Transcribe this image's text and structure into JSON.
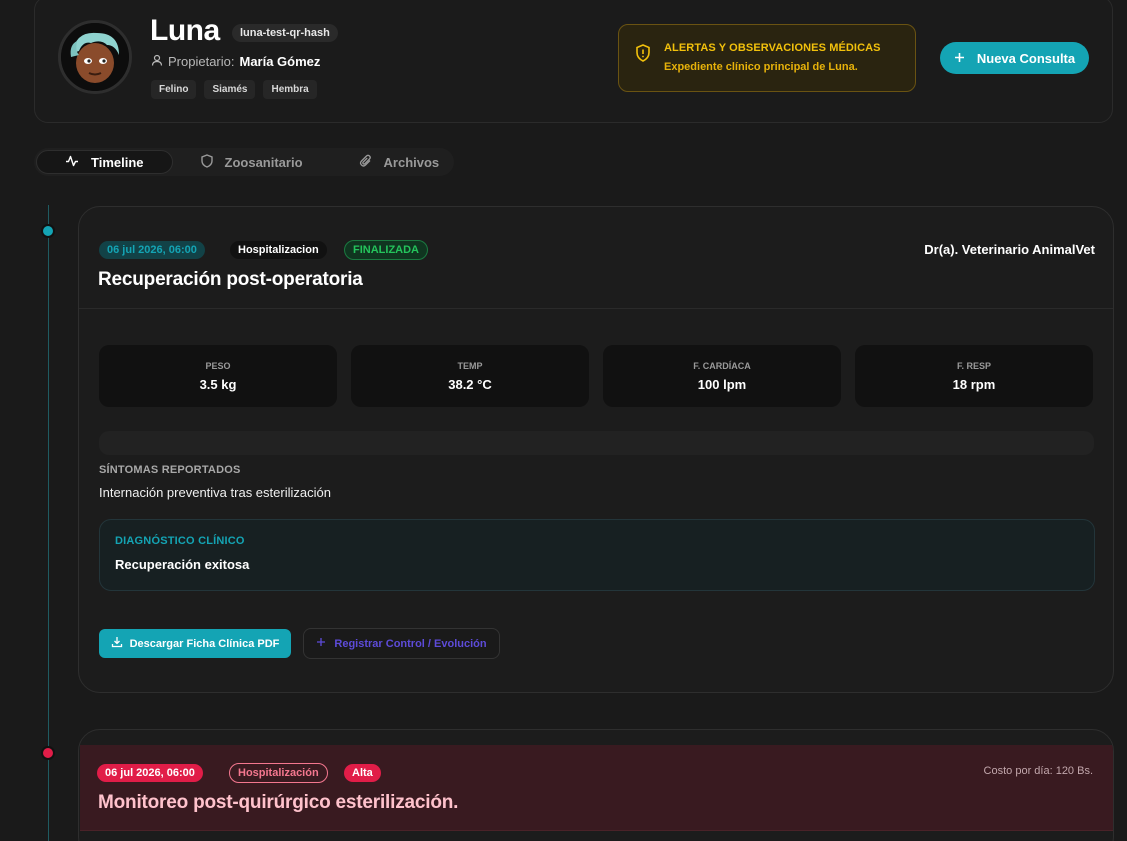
{
  "patient": {
    "name": "Luna",
    "hash": "luna-test-qr-hash",
    "owner_label": "Propietario:",
    "owner_name": "María Gómez",
    "tags": [
      "Felino",
      "Siamés",
      "Hembra"
    ]
  },
  "alert": {
    "title": "ALERTAS Y OBSERVACIONES MÉDICAS",
    "text": "Expediente clínico principal de Luna."
  },
  "actions": {
    "new_consult": "Nueva Consulta"
  },
  "tabs": [
    {
      "label": "Timeline",
      "icon": "activity-icon",
      "active": true
    },
    {
      "label": "Zoosanitario",
      "icon": "shield-icon",
      "active": false
    },
    {
      "label": "Archivos",
      "icon": "paperclip-icon",
      "active": false
    }
  ],
  "entry1": {
    "date": "06 jul 2026, 06:00",
    "type": "Hospitalizacion",
    "status": "FINALIZADA",
    "vet": "Dr(a). Veterinario AnimalVet",
    "title": "Recuperación post-operatoria",
    "vitals": [
      {
        "label": "PESO",
        "value": "3.5 kg"
      },
      {
        "label": "TEMP",
        "value": "38.2 °C"
      },
      {
        "label": "F. CARDÍACA",
        "value": "100 lpm"
      },
      {
        "label": "F. RESP",
        "value": "18 rpm"
      }
    ],
    "symptoms_label": "SÍNTOMAS REPORTADOS",
    "symptoms": "Internación preventiva tras esterilización",
    "diagnosis_label": "DIAGNÓSTICO CLÍNICO",
    "diagnosis": "Recuperación exitosa",
    "pdf_button": "Descargar Ficha Clínica PDF",
    "control_button": "Registrar Control / Evolución"
  },
  "entry2": {
    "date": "06 jul 2026, 06:00",
    "type": "Hospitalización",
    "priority": "Alta",
    "cost": "Costo por día: 120 Bs.",
    "title": "Monitoreo post-quirúrgico esterilización."
  },
  "colors": {
    "accent": "#14a4b4",
    "warning": "#f2c10c",
    "danger": "#e11d48",
    "success": "#24c45c",
    "background": "#1a1a1a"
  }
}
